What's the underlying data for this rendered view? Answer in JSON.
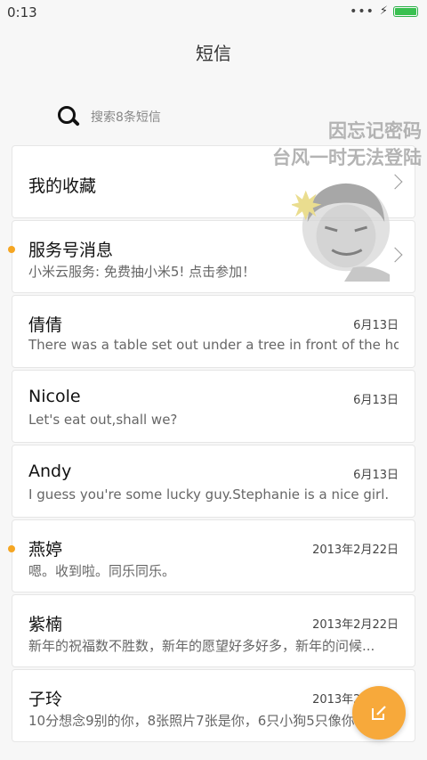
{
  "status_bar": {
    "time": "0:13"
  },
  "header": {
    "title": "短信"
  },
  "search": {
    "placeholder": "搜索8条短信"
  },
  "watermark": {
    "line1": "因忘记密码",
    "line2": "台风一时无法登陆"
  },
  "unread_color": "#f5a623",
  "fab_color": "#f7a93b",
  "conversations": [
    {
      "name": "我的收藏",
      "preview": "",
      "date": "",
      "unread": false,
      "chevron": true
    },
    {
      "name": "服务号消息",
      "preview": "小米云服务: 免费抽小米5! 点击参加！",
      "date": "",
      "unread": true,
      "chevron": true
    },
    {
      "name": "倩倩",
      "preview": "There was a table set out under a tree in front of the ho...",
      "date": "6月13日",
      "unread": false
    },
    {
      "name": "Nicole",
      "preview": "Let's eat out,shall we?",
      "date": "6月13日",
      "unread": false
    },
    {
      "name": "Andy",
      "preview": "I guess you're some lucky guy.Stephanie is a nice girl.",
      "date": "6月13日",
      "unread": false
    },
    {
      "name": "燕婷",
      "preview": "嗯。收到啦。同乐同乐。",
      "date": "2013年2月22日",
      "unread": true
    },
    {
      "name": "紫楠",
      "preview": "新年的祝福数不胜数，新年的愿望好多好多，新年的问候...",
      "date": "2013年2月22日",
      "unread": false
    },
    {
      "name": "子玲",
      "preview": "10分想念9别的你，8张照片7张是你，6只小狗5只像你",
      "date": "2013年2月22日",
      "unread": false
    }
  ],
  "icons": {
    "search": "search-icon",
    "compose": "compose-icon",
    "chevron": "chevron-right-icon",
    "battery": "battery-icon",
    "charging": "charging-icon",
    "more": "more-dots-icon"
  }
}
